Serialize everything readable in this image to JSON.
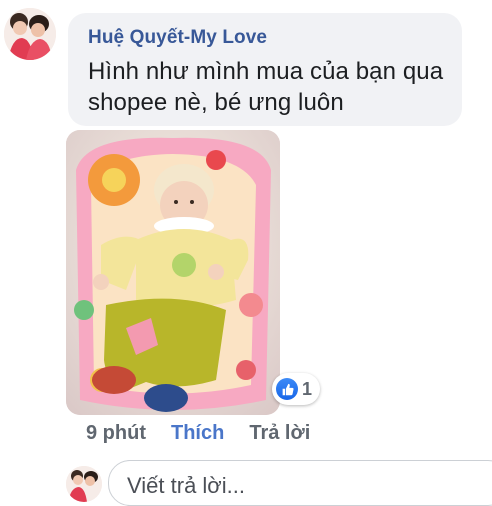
{
  "comment": {
    "author": "Huệ Quyết-My Love",
    "text": "Hình như mình mua của bạn qua shopee nè, bé ưng luôn",
    "reaction": {
      "icon": "like-icon",
      "count": "1",
      "color": "#1877f2"
    },
    "actions": {
      "time": "9 phút",
      "like": "Thích",
      "reply": "Trả lời"
    }
  },
  "reply_box": {
    "placeholder": "Viết trả lời..."
  },
  "colors": {
    "author": "#385898",
    "bubble": "#f1f2f5",
    "like_action": "#4a76c9"
  }
}
